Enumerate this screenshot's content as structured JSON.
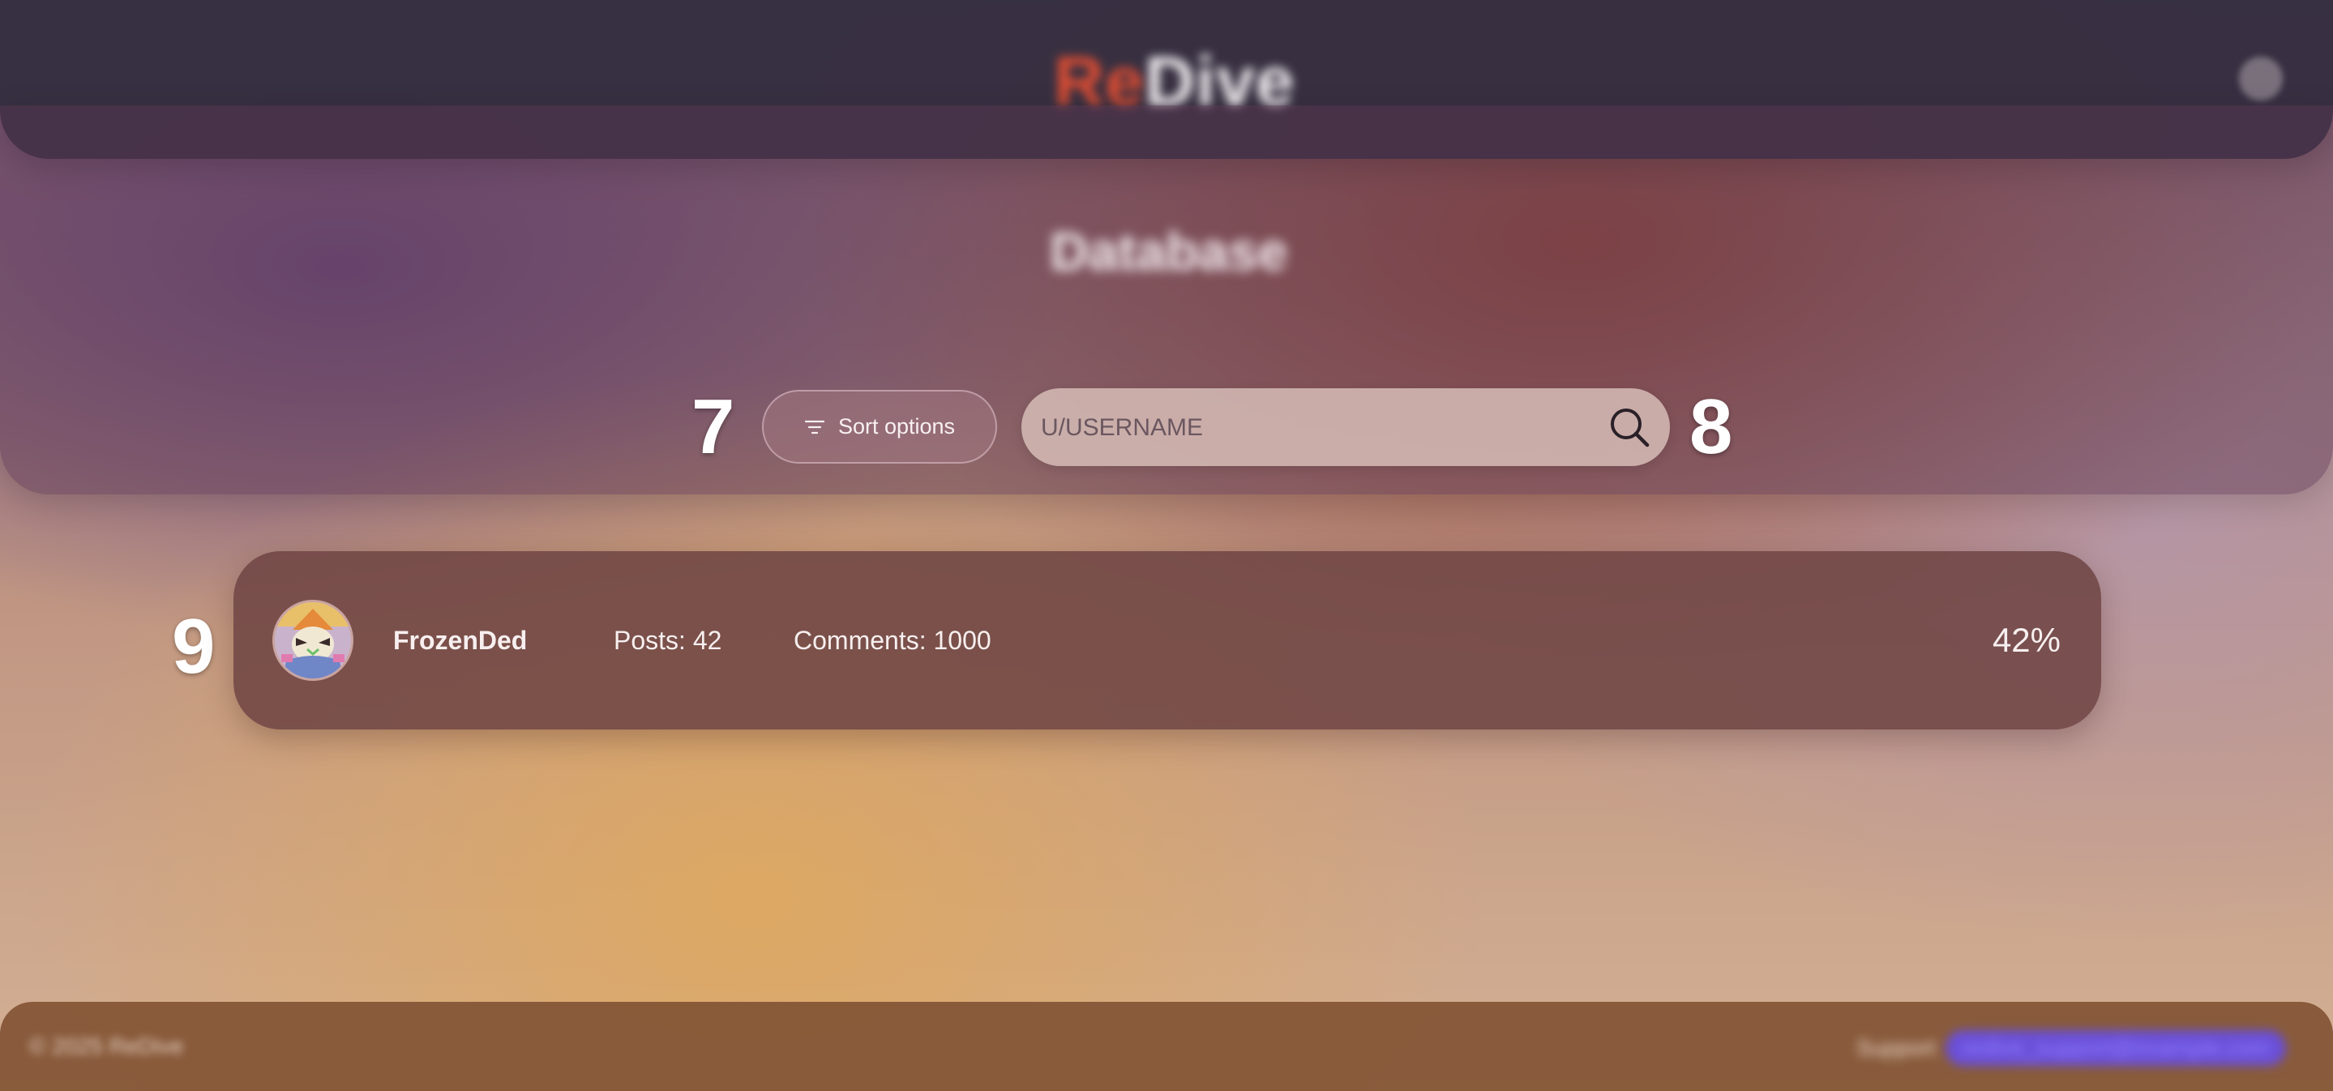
{
  "app": {
    "logo_part1": "Re",
    "logo_part2": "Dive"
  },
  "page": {
    "title": "Database"
  },
  "markers": {
    "sort": "7",
    "search": "8",
    "card": "9"
  },
  "controls": {
    "sort_label": "Sort options",
    "search_placeholder": "U/USERNAME"
  },
  "user_card": {
    "username": "FrozenDed",
    "posts": "Posts: 42",
    "comments": "Comments: 1000",
    "percent": "42%"
  },
  "footer": {
    "copyright": "© 2025 ReDive",
    "support_label": "Support",
    "support_link": "redive_support@example.com"
  },
  "colors": {
    "accent": "#e24e33",
    "link": "#6a4fd8"
  }
}
